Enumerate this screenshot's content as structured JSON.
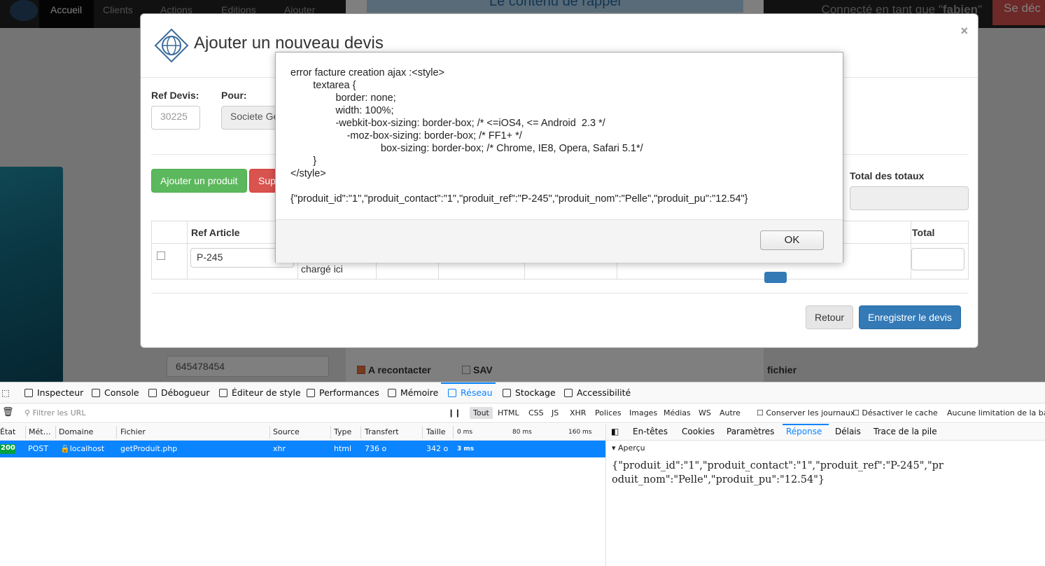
{
  "navbar": {
    "home": "Accueil",
    "clients": "Clients",
    "actions": "Actions",
    "editions": "Editions",
    "ajouter": "Ajouter",
    "logged_in": "Connecté en tant que",
    "username": "fabien",
    "logout": "Se déc"
  },
  "background": {
    "banner": "Le contenu de rappel",
    "phone": "645478454",
    "recontact_label": "A recontacter",
    "sav_label": "SAV",
    "fichier_label": "fichier"
  },
  "modal": {
    "title": "Ajouter un nouveau devis",
    "close": "×",
    "ref_devis_label": "Ref Devis:",
    "ref_devis_value": "30225",
    "pour_label": "Pour:",
    "pour_value": "Societe Ge",
    "add_product": "Ajouter un produit",
    "delete_product": "Sup",
    "total_totaux_label": "Total des totaux",
    "table": {
      "col_ref": "Ref Article",
      "col_total": "Total",
      "ref_value": "P-245",
      "loaded_text": "chargé ici"
    },
    "retour": "Retour",
    "save": "Enregistrer le devis"
  },
  "alert": {
    "message": "error facture creation ajax :<style>\n        textarea {\n                border: none;\n                width: 100%;\n                -webkit-box-sizing: border-box; /* <=iOS4, <= Android  2.3 */\n                    -moz-box-sizing: border-box; /* FF1+ */\n                                box-sizing: border-box; /* Chrome, IE8, Opera, Safari 5.1*/\n        }\n</style>\n\n{\"produit_id\":\"1\",\"produit_contact\":\"1\",\"produit_ref\":\"P-245\",\"produit_nom\":\"Pelle\",\"produit_pu\":\"12.54\"}",
    "ok": "OK"
  },
  "devtools": {
    "tabs": [
      "Inspecteur",
      "Console",
      "Débogueur",
      "Éditeur de style",
      "Performances",
      "Mémoire",
      "Réseau",
      "Stockage",
      "Accessibilité"
    ],
    "filter_placeholder": "Filtrer les URL",
    "pause": "❙❙",
    "filters": [
      "Tout",
      "HTML",
      "CSS",
      "JS",
      "XHR",
      "Polices",
      "Images",
      "Médias",
      "WS",
      "Autre"
    ],
    "persist_logs": "Conserver les journaux",
    "disable_cache": "Désactiver le cache",
    "throttling": "Aucune limitation de la band",
    "columns": [
      "État",
      "Mét…",
      "Domaine",
      "Fichier",
      "Source",
      "Type",
      "Transfert",
      "Taille",
      "0 ms",
      "80 ms",
      "160 ms"
    ],
    "request": {
      "status": "200",
      "method": "POST",
      "domain": "localhost",
      "file": "getProduit.php",
      "source": "xhr",
      "type": "html",
      "transfer": "736 o",
      "size": "342 o",
      "timing": "3 ms"
    },
    "side_tabs": [
      "En-têtes",
      "Cookies",
      "Paramètres",
      "Réponse",
      "Délais",
      "Trace de la pile"
    ],
    "apercu": "Aperçu",
    "response": "{\"produit_id\":\"1\",\"produit_contact\":\"1\",\"produit_ref\":\"P-245\",\"produit_nom\":\"Pelle\",\"produit_pu\":\"12.54\"}"
  }
}
